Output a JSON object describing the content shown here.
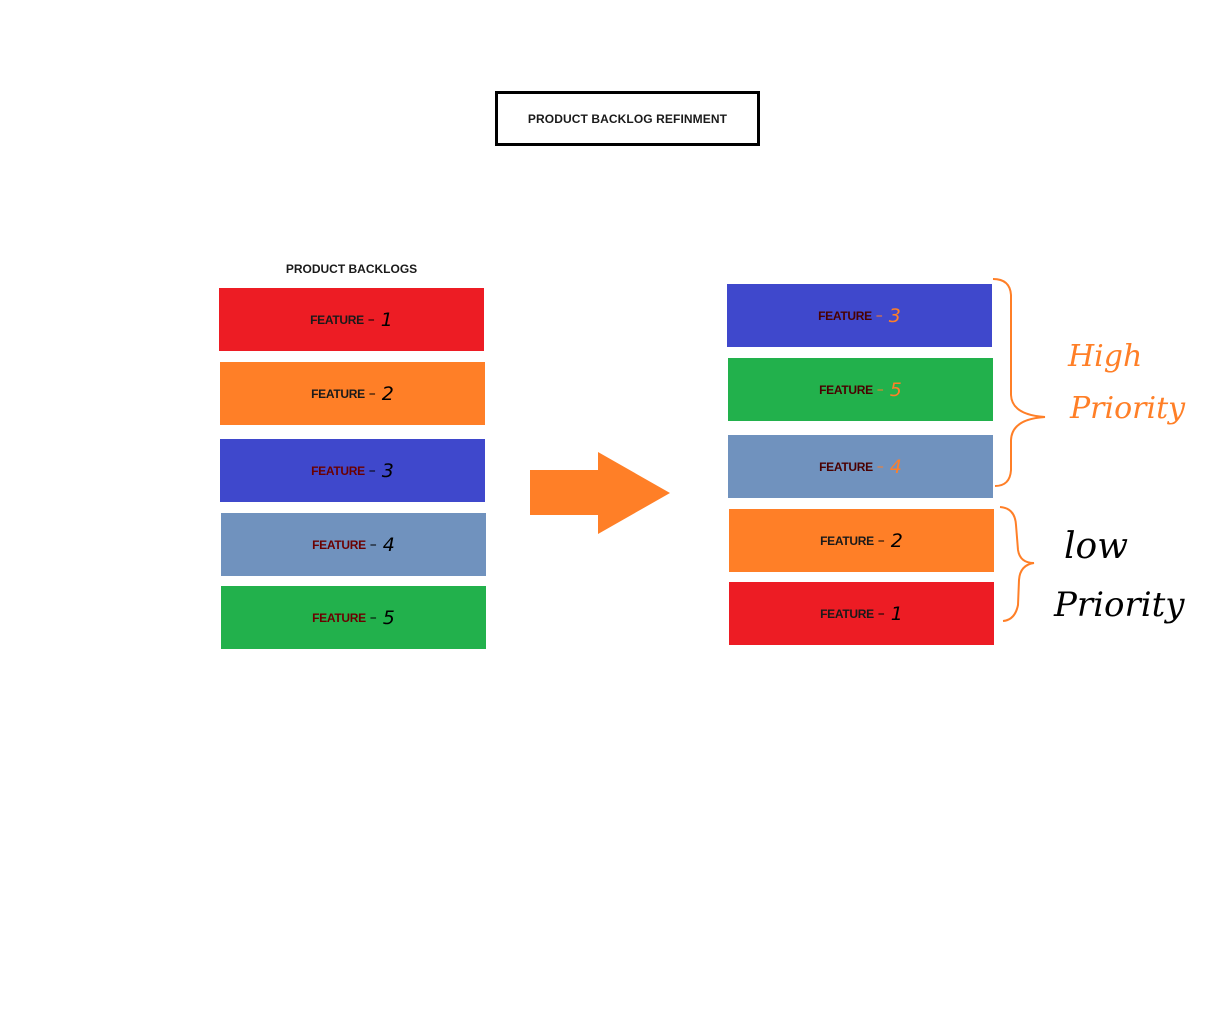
{
  "title": "PRODUCT BACKLOG REFINMENT",
  "backlog_heading": "PRODUCT BACKLOGS",
  "feature_word": "FEATURE",
  "colors": {
    "red": "#ed1c24",
    "orange": "#ff7f27",
    "blue": "#3f48cc",
    "steel": "#7092be",
    "green": "#22b14c",
    "arrow": "#ff7f27",
    "high_priority": "#ff7f27",
    "low_priority": "#000000"
  },
  "backlog_items": [
    {
      "number": "1",
      "color": "red"
    },
    {
      "number": "2",
      "color": "orange"
    },
    {
      "number": "3",
      "color": "blue"
    },
    {
      "number": "4",
      "color": "steel"
    },
    {
      "number": "5",
      "color": "green"
    }
  ],
  "refined_items": [
    {
      "number": "3",
      "color": "blue",
      "priority": "high"
    },
    {
      "number": "5",
      "color": "green",
      "priority": "high"
    },
    {
      "number": "4",
      "color": "steel",
      "priority": "high"
    },
    {
      "number": "2",
      "color": "orange",
      "priority": "low"
    },
    {
      "number": "1",
      "color": "red",
      "priority": "low"
    }
  ],
  "groups": {
    "high": {
      "line1": "High",
      "line2": "Priority"
    },
    "low": {
      "line1": "low",
      "line2": "Priority"
    }
  }
}
